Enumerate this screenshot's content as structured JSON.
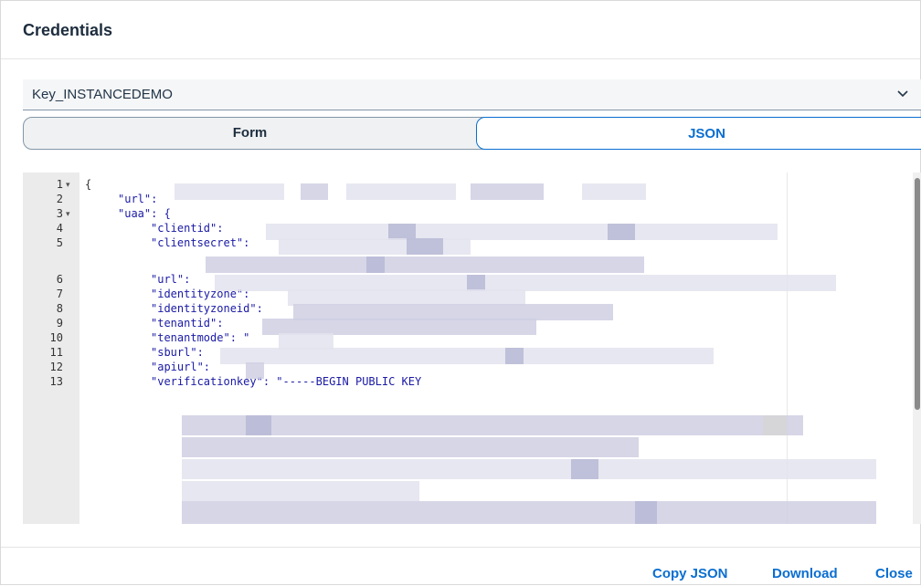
{
  "dialog": {
    "title": "Credentials"
  },
  "key_select": {
    "value": "Key_INSTANCEDEMO",
    "icon": "chevron-down-icon"
  },
  "tabs": [
    {
      "label": "Form",
      "selected": false
    },
    {
      "label": "JSON",
      "selected": true
    }
  ],
  "editor": {
    "lines": [
      {
        "n": "1",
        "text": "{",
        "fold": true
      },
      {
        "n": "2",
        "text": "\"url\":",
        "fold": false
      },
      {
        "n": "3",
        "text": "\"uaa\": {",
        "fold": true
      },
      {
        "n": "4",
        "text": "\"clientid\":",
        "fold": false
      },
      {
        "n": "5",
        "text": "\"clientsecret\":",
        "fold": false
      },
      {
        "n": "6",
        "text": "\"url\":",
        "fold": false
      },
      {
        "n": "7",
        "text": "\"identityzone\":",
        "fold": false
      },
      {
        "n": "8",
        "text": "\"identityzoneid\":",
        "fold": false
      },
      {
        "n": "9",
        "text": "\"tenantid\":",
        "fold": false
      },
      {
        "n": "10",
        "text": "\"tenantmode\": \"",
        "fold": false
      },
      {
        "n": "11",
        "text": "\"sburl\":",
        "fold": false
      },
      {
        "n": "12",
        "text": "\"apiurl\":",
        "fold": false
      },
      {
        "n": "13",
        "text": "\"verificationkey\": \"-----BEGIN PUBLIC KEY",
        "fold": false
      }
    ]
  },
  "footer": {
    "copy_json": "Copy JSON",
    "download": "Download",
    "close": "Close"
  },
  "colors": {
    "accent": "#0a6ed1",
    "title": "#1d2d3e"
  }
}
